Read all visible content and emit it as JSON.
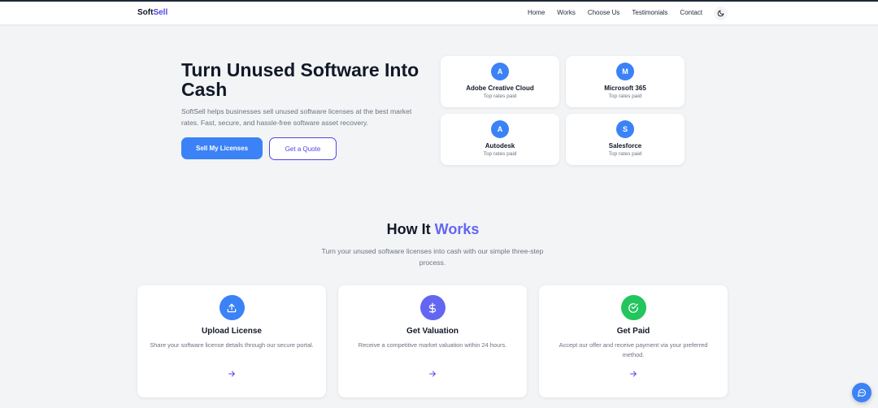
{
  "navbar": {
    "logo_part1": "Soft",
    "logo_part2": "Sell",
    "links": [
      "Home",
      "Works",
      "Choose Us",
      "Testimonials",
      "Contact"
    ],
    "theme_toggle_icon": "moon-icon"
  },
  "hero": {
    "title": "Turn Unused Software Into Cash",
    "subtitle": "SoftSell helps businesses sell unused software licenses at the best market rates. Fast, secure, and hassle-free software asset recovery.",
    "primary_button": "Sell My Licenses",
    "secondary_button": "Get a Quote"
  },
  "partners": [
    {
      "initial": "A",
      "name": "Adobe Creative Cloud",
      "note": "Top rates paid"
    },
    {
      "initial": "M",
      "name": "Microsoft 365",
      "note": "Top rates paid"
    },
    {
      "initial": "A",
      "name": "Autodesk",
      "note": "Top rates paid"
    },
    {
      "initial": "S",
      "name": "Salesforce",
      "note": "Top rates paid"
    }
  ],
  "how_it_works": {
    "title_part1": "How It",
    "title_part2": "Works",
    "subtitle": "Turn your unused software licenses into cash with our simple three-step process.",
    "steps": [
      {
        "icon": "upload-icon",
        "color": "#3b82f6",
        "title": "Upload License",
        "description": "Share your software license details through our secure portal."
      },
      {
        "icon": "dollar-icon",
        "color": "#6366f1",
        "title": "Get Valuation",
        "description": "Receive a competitive market valuation within 24 hours."
      },
      {
        "icon": "check-circle-icon",
        "color": "#22c55e",
        "title": "Get Paid",
        "description": "Accept our offer and receive payment via your preferred method."
      }
    ]
  },
  "colors": {
    "primary": "#3b82f6",
    "accent": "#4f46e5",
    "success": "#22c55e",
    "background": "#f3f4f6"
  },
  "chat_button_icon": "chat-icon"
}
